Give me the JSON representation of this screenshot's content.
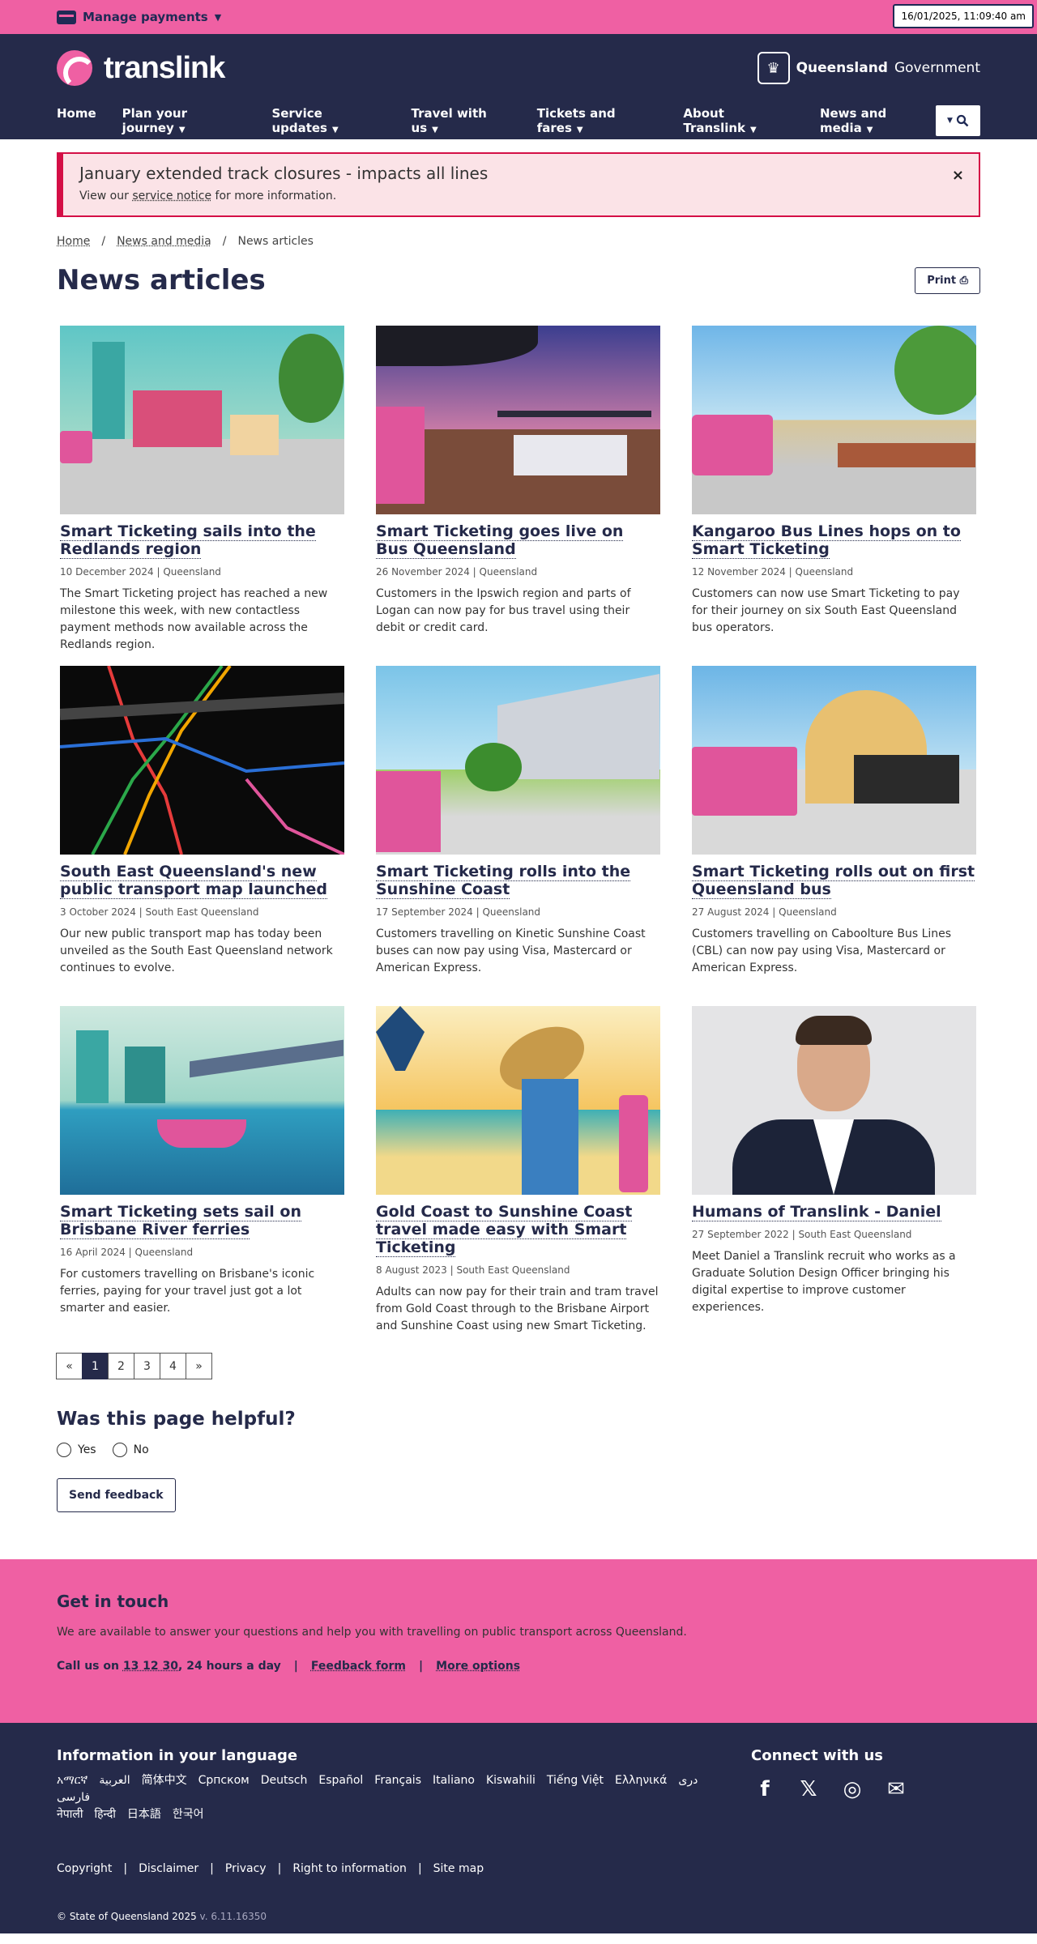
{
  "topbar": {
    "manage_payments": "Manage payments",
    "datetime": "16/01/2025, 11:09:40 am"
  },
  "header": {
    "logo_text": "translink",
    "gov_bold": "Queensland",
    "gov_light": "Government"
  },
  "nav": {
    "items": [
      "Home",
      "Plan your journey",
      "Service updates",
      "Travel with us",
      "Tickets and fares",
      "About Translink",
      "News and media"
    ]
  },
  "alert": {
    "title": "January extended track closures - impacts all lines",
    "text_before": "View our ",
    "link": "service notice",
    "text_after": " for more information.",
    "close": "×"
  },
  "breadcrumb": {
    "items": [
      "Home",
      "News and media",
      "News articles"
    ],
    "sep": "/"
  },
  "page": {
    "title": "News articles",
    "print": "Print"
  },
  "articles": [
    {
      "title": "Smart Ticketing sails into the Redlands region",
      "meta": "10 December 2024 | Queensland",
      "desc": "The Smart Ticketing project has reached a new milestone this week, with new contactless payment methods now available across the Redlands region."
    },
    {
      "title": "Smart Ticketing goes live on Bus Queensland",
      "meta": "26 November 2024 | Queensland",
      "desc": "Customers in the Ipswich region and parts of Logan can now pay for bus travel using their debit or credit card."
    },
    {
      "title": "Kangaroo Bus Lines hops on to Smart Ticketing",
      "meta": "12 November 2024 | Queensland",
      "desc": "Customers can now use Smart Ticketing to pay for their journey on six South East Queensland bus operators."
    },
    {
      "title": "South East Queensland's new public transport map launched",
      "meta": "3 October 2024 | South East Queensland",
      "desc": "Our new public transport map has today been unveiled as the South East Queensland network continues to evolve."
    },
    {
      "title": "Smart Ticketing rolls into the Sunshine Coast",
      "meta": "17 September 2024 | Queensland",
      "desc": "Customers travelling on Kinetic Sunshine Coast buses can now pay using Visa, Mastercard or American Express."
    },
    {
      "title": "Smart Ticketing rolls out on first Queensland bus",
      "meta": "27 August 2024 | Queensland",
      "desc": "Customers travelling on Caboolture Bus Lines (CBL) can now pay using Visa, Mastercard or American Express."
    },
    {
      "title": "Smart Ticketing sets sail on Brisbane River ferries",
      "meta": "16 April 2024 | Queensland",
      "desc": "For customers travelling on Brisbane's iconic ferries, paying for your travel just got a lot smarter and easier."
    },
    {
      "title": "Gold Coast to Sunshine Coast travel made easy with Smart Ticketing",
      "meta": "8 August 2023 | South East Queensland",
      "desc": "Adults can now pay for their train and tram travel from Gold Coast through to the Brisbane Airport and Sunshine Coast using new Smart Ticketing."
    },
    {
      "title": "Humans of Translink - Daniel",
      "meta": "27 September 2022 | South East Queensland",
      "desc": "Meet Daniel a Translink recruit who works as a Graduate Solution Design Officer bringing his digital expertise to improve customer experiences."
    }
  ],
  "pagination": [
    "«",
    "1",
    "2",
    "3",
    "4",
    "»"
  ],
  "helpful": {
    "title": "Was this page helpful?",
    "yes": "Yes",
    "no": "No",
    "send": "Send feedback"
  },
  "contact": {
    "title": "Get in touch",
    "text": "We are available to answer your questions and help you with travelling on public transport across Queensland.",
    "call_prefix": "Call us on ",
    "phone": "13 12 30",
    "call_suffix": ", 24 hours a day",
    "sep": "|",
    "feedback": "Feedback form",
    "more": "More options"
  },
  "footer": {
    "lang_title": "Information in your language",
    "languages": [
      "አማርኛ",
      "العربية",
      "简体中文",
      "Српском",
      "Deutsch",
      "Español",
      "Français",
      "Italiano",
      "Kiswahili",
      "Tiếng Việt",
      "Ελληνικά",
      "دری",
      "فارسی",
      "नेपाली",
      "हिन्दी",
      "日本語",
      "한국어"
    ],
    "connect_title": "Connect with us",
    "links": [
      "Copyright",
      "Disclaimer",
      "Privacy",
      "Right to information",
      "Site map"
    ],
    "sep": "|",
    "copyright": "© State of Queensland 2025",
    "version": "v. 6.11.16350"
  },
  "colors": {
    "pink": "#ef60a3",
    "navy": "#252a4a",
    "alert_red": "#d40f46"
  }
}
